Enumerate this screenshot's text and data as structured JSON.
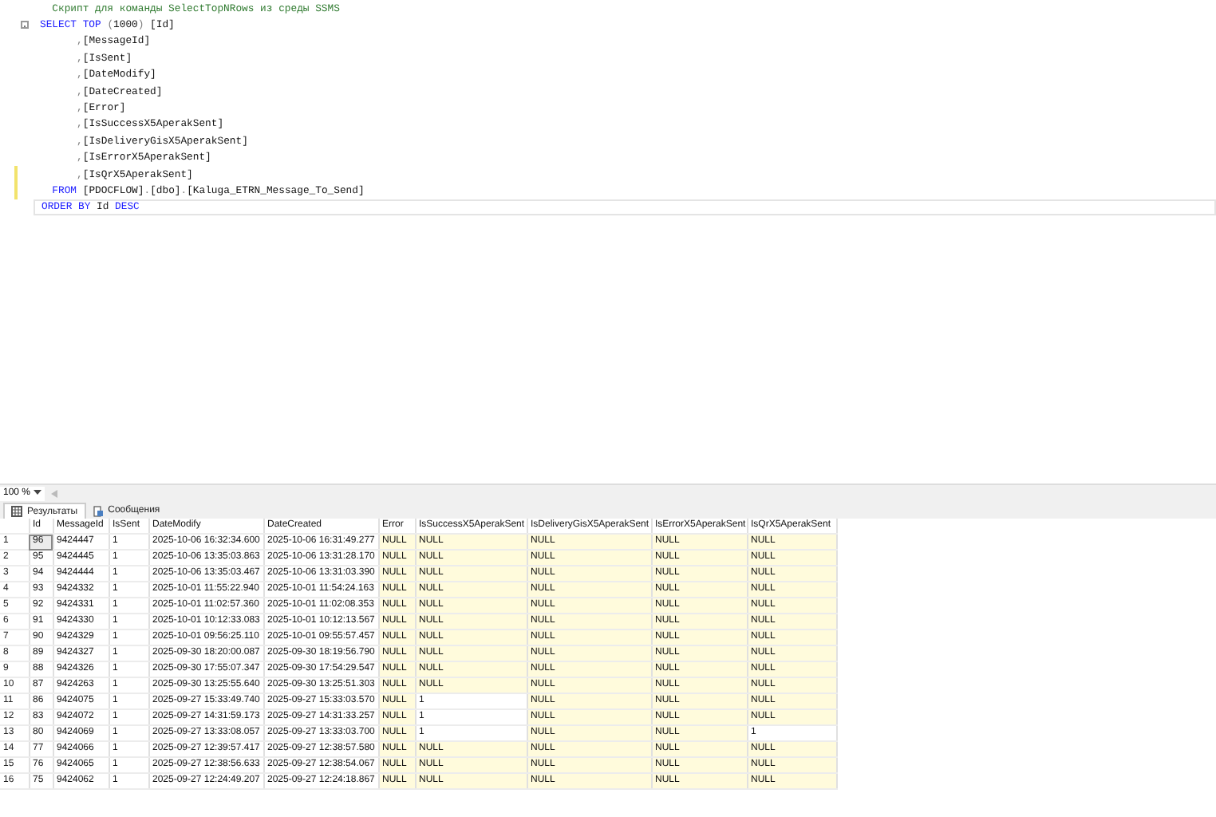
{
  "editor": {
    "lines": [
      {
        "changed": false,
        "current": false,
        "fold": false,
        "kind": "comment",
        "tokens": [
          {
            "text": "Скрипт для команды SelectTopNRows из среды SSMS",
            "kind": "comment"
          }
        ]
      },
      {
        "changed": false,
        "current": false,
        "fold": true,
        "kind": "select",
        "tokens": [
          {
            "text": "SELECT TOP ",
            "kind": "keyword"
          },
          {
            "text": "(",
            "kind": "punct"
          },
          {
            "text": "1000",
            "kind": "plain"
          },
          {
            "text": ") ",
            "kind": "punct"
          },
          {
            "text": "[Id]",
            "kind": "plain"
          }
        ]
      },
      {
        "changed": false,
        "current": false,
        "fold": false,
        "kind": "column",
        "tokens": [
          {
            "text": ",",
            "kind": "punct"
          },
          {
            "text": "[MessageId]",
            "kind": "plain"
          }
        ]
      },
      {
        "changed": false,
        "current": false,
        "fold": false,
        "kind": "column",
        "tokens": [
          {
            "text": ",",
            "kind": "punct"
          },
          {
            "text": "[IsSent]",
            "kind": "plain"
          }
        ]
      },
      {
        "changed": false,
        "current": false,
        "fold": false,
        "kind": "column",
        "tokens": [
          {
            "text": ",",
            "kind": "punct"
          },
          {
            "text": "[DateModify]",
            "kind": "plain"
          }
        ]
      },
      {
        "changed": false,
        "current": false,
        "fold": false,
        "kind": "column",
        "tokens": [
          {
            "text": ",",
            "kind": "punct"
          },
          {
            "text": "[DateCreated]",
            "kind": "plain"
          }
        ]
      },
      {
        "changed": false,
        "current": false,
        "fold": false,
        "kind": "column",
        "tokens": [
          {
            "text": ",",
            "kind": "punct"
          },
          {
            "text": "[Error]",
            "kind": "plain"
          }
        ]
      },
      {
        "changed": false,
        "current": false,
        "fold": false,
        "kind": "column",
        "tokens": [
          {
            "text": ",",
            "kind": "punct"
          },
          {
            "text": "[IsSuccessX5AperakSent]",
            "kind": "plain"
          }
        ]
      },
      {
        "changed": false,
        "current": false,
        "fold": false,
        "kind": "column",
        "tokens": [
          {
            "text": ",",
            "kind": "punct"
          },
          {
            "text": "[IsDeliveryGisX5AperakSent]",
            "kind": "plain"
          }
        ]
      },
      {
        "changed": false,
        "current": false,
        "fold": false,
        "kind": "column",
        "tokens": [
          {
            "text": ",",
            "kind": "punct"
          },
          {
            "text": "[IsErrorX5AperakSent]",
            "kind": "plain"
          }
        ]
      },
      {
        "changed": true,
        "current": false,
        "fold": false,
        "kind": "column",
        "tokens": [
          {
            "text": ",",
            "kind": "punct"
          },
          {
            "text": "[IsQrX5AperakSent]",
            "kind": "plain"
          }
        ]
      },
      {
        "changed": true,
        "current": false,
        "fold": false,
        "kind": "from",
        "tokens": [
          {
            "text": "FROM ",
            "kind": "keyword"
          },
          {
            "text": "[PDOCFLOW]",
            "kind": "plain"
          },
          {
            "text": ".",
            "kind": "punct"
          },
          {
            "text": "[dbo]",
            "kind": "plain"
          },
          {
            "text": ".",
            "kind": "punct"
          },
          {
            "text": "[Kaluga_ETRN_Message_To_Send]",
            "kind": "plain"
          }
        ]
      },
      {
        "changed": false,
        "current": true,
        "fold": false,
        "kind": "order",
        "tokens": [
          {
            "text": "ORDER BY ",
            "kind": "keyword"
          },
          {
            "text": "Id ",
            "kind": "plain"
          },
          {
            "text": "DESC",
            "kind": "keyword"
          }
        ]
      }
    ]
  },
  "zoom": {
    "value": "100 %"
  },
  "tabs": [
    {
      "label": "Результаты",
      "selected": true
    },
    {
      "label": "Сообщения",
      "selected": false
    }
  ],
  "table": {
    "columns": [
      "Id",
      "MessageId",
      "IsSent",
      "DateModify",
      "DateCreated",
      "Error",
      "IsSuccessX5AperakSent",
      "IsDeliveryGisX5AperakSent",
      "IsErrorX5AperakSent",
      "IsQrX5AperakSent"
    ],
    "rows": [
      {
        "row_number": "1",
        "selected": true,
        "cells": [
          "96",
          "9424447",
          "1",
          "2025-10-06 16:32:34.600",
          "2025-10-06 16:31:49.277"
        ],
        "flags": [
          {
            "text": "NULL",
            "null": true
          },
          {
            "text": "NULL",
            "null": true
          },
          {
            "text": "NULL",
            "null": true
          },
          {
            "text": "NULL",
            "null": true
          },
          {
            "text": "NULL",
            "null": true
          }
        ]
      },
      {
        "row_number": "2",
        "selected": false,
        "cells": [
          "95",
          "9424445",
          "1",
          "2025-10-06 13:35:03.863",
          "2025-10-06 13:31:28.170"
        ],
        "flags": [
          {
            "text": "NULL",
            "null": true
          },
          {
            "text": "NULL",
            "null": true
          },
          {
            "text": "NULL",
            "null": true
          },
          {
            "text": "NULL",
            "null": true
          },
          {
            "text": "NULL",
            "null": true
          }
        ]
      },
      {
        "row_number": "3",
        "selected": false,
        "cells": [
          "94",
          "9424444",
          "1",
          "2025-10-06 13:35:03.467",
          "2025-10-06 13:31:03.390"
        ],
        "flags": [
          {
            "text": "NULL",
            "null": true
          },
          {
            "text": "NULL",
            "null": true
          },
          {
            "text": "NULL",
            "null": true
          },
          {
            "text": "NULL",
            "null": true
          },
          {
            "text": "NULL",
            "null": true
          }
        ]
      },
      {
        "row_number": "4",
        "selected": false,
        "cells": [
          "93",
          "9424332",
          "1",
          "2025-10-01 11:55:22.940",
          "2025-10-01 11:54:24.163"
        ],
        "flags": [
          {
            "text": "NULL",
            "null": true
          },
          {
            "text": "NULL",
            "null": true
          },
          {
            "text": "NULL",
            "null": true
          },
          {
            "text": "NULL",
            "null": true
          },
          {
            "text": "NULL",
            "null": true
          }
        ]
      },
      {
        "row_number": "5",
        "selected": false,
        "cells": [
          "92",
          "9424331",
          "1",
          "2025-10-01 11:02:57.360",
          "2025-10-01 11:02:08.353"
        ],
        "flags": [
          {
            "text": "NULL",
            "null": true
          },
          {
            "text": "NULL",
            "null": true
          },
          {
            "text": "NULL",
            "null": true
          },
          {
            "text": "NULL",
            "null": true
          },
          {
            "text": "NULL",
            "null": true
          }
        ]
      },
      {
        "row_number": "6",
        "selected": false,
        "cells": [
          "91",
          "9424330",
          "1",
          "2025-10-01 10:12:33.083",
          "2025-10-01 10:12:13.567"
        ],
        "flags": [
          {
            "text": "NULL",
            "null": true
          },
          {
            "text": "NULL",
            "null": true
          },
          {
            "text": "NULL",
            "null": true
          },
          {
            "text": "NULL",
            "null": true
          },
          {
            "text": "NULL",
            "null": true
          }
        ]
      },
      {
        "row_number": "7",
        "selected": false,
        "cells": [
          "90",
          "9424329",
          "1",
          "2025-10-01 09:56:25.110",
          "2025-10-01 09:55:57.457"
        ],
        "flags": [
          {
            "text": "NULL",
            "null": true
          },
          {
            "text": "NULL",
            "null": true
          },
          {
            "text": "NULL",
            "null": true
          },
          {
            "text": "NULL",
            "null": true
          },
          {
            "text": "NULL",
            "null": true
          }
        ]
      },
      {
        "row_number": "8",
        "selected": false,
        "cells": [
          "89",
          "9424327",
          "1",
          "2025-09-30 18:20:00.087",
          "2025-09-30 18:19:56.790"
        ],
        "flags": [
          {
            "text": "NULL",
            "null": true
          },
          {
            "text": "NULL",
            "null": true
          },
          {
            "text": "NULL",
            "null": true
          },
          {
            "text": "NULL",
            "null": true
          },
          {
            "text": "NULL",
            "null": true
          }
        ]
      },
      {
        "row_number": "9",
        "selected": false,
        "cells": [
          "88",
          "9424326",
          "1",
          "2025-09-30 17:55:07.347",
          "2025-09-30 17:54:29.547"
        ],
        "flags": [
          {
            "text": "NULL",
            "null": true
          },
          {
            "text": "NULL",
            "null": true
          },
          {
            "text": "NULL",
            "null": true
          },
          {
            "text": "NULL",
            "null": true
          },
          {
            "text": "NULL",
            "null": true
          }
        ]
      },
      {
        "row_number": "10",
        "selected": false,
        "cells": [
          "87",
          "9424263",
          "1",
          "2025-09-30 13:25:55.640",
          "2025-09-30 13:25:51.303"
        ],
        "flags": [
          {
            "text": "NULL",
            "null": true
          },
          {
            "text": "NULL",
            "null": true
          },
          {
            "text": "NULL",
            "null": true
          },
          {
            "text": "NULL",
            "null": true
          },
          {
            "text": "NULL",
            "null": true
          }
        ]
      },
      {
        "row_number": "11",
        "selected": false,
        "cells": [
          "86",
          "9424075",
          "1",
          "2025-09-27 15:33:49.740",
          "2025-09-27 15:33:03.570"
        ],
        "flags": [
          {
            "text": "NULL",
            "null": true
          },
          {
            "text": "1",
            "null": false
          },
          {
            "text": "NULL",
            "null": true
          },
          {
            "text": "NULL",
            "null": true
          },
          {
            "text": "NULL",
            "null": true
          }
        ]
      },
      {
        "row_number": "12",
        "selected": false,
        "cells": [
          "83",
          "9424072",
          "1",
          "2025-09-27 14:31:59.173",
          "2025-09-27 14:31:33.257"
        ],
        "flags": [
          {
            "text": "NULL",
            "null": true
          },
          {
            "text": "1",
            "null": false
          },
          {
            "text": "NULL",
            "null": true
          },
          {
            "text": "NULL",
            "null": true
          },
          {
            "text": "NULL",
            "null": true
          }
        ]
      },
      {
        "row_number": "13",
        "selected": false,
        "cells": [
          "80",
          "9424069",
          "1",
          "2025-09-27 13:33:08.057",
          "2025-09-27 13:33:03.700"
        ],
        "flags": [
          {
            "text": "NULL",
            "null": true
          },
          {
            "text": "1",
            "null": false
          },
          {
            "text": "NULL",
            "null": true
          },
          {
            "text": "NULL",
            "null": true
          },
          {
            "text": "1",
            "null": false
          }
        ]
      },
      {
        "row_number": "14",
        "selected": false,
        "cells": [
          "77",
          "9424066",
          "1",
          "2025-09-27 12:39:57.417",
          "2025-09-27 12:38:57.580"
        ],
        "flags": [
          {
            "text": "NULL",
            "null": true
          },
          {
            "text": "NULL",
            "null": true
          },
          {
            "text": "NULL",
            "null": true
          },
          {
            "text": "NULL",
            "null": true
          },
          {
            "text": "NULL",
            "null": true
          }
        ]
      },
      {
        "row_number": "15",
        "selected": false,
        "cells": [
          "76",
          "9424065",
          "1",
          "2025-09-27 12:38:56.633",
          "2025-09-27 12:38:54.067"
        ],
        "flags": [
          {
            "text": "NULL",
            "null": true
          },
          {
            "text": "NULL",
            "null": true
          },
          {
            "text": "NULL",
            "null": true
          },
          {
            "text": "NULL",
            "null": true
          },
          {
            "text": "NULL",
            "null": true
          }
        ]
      },
      {
        "row_number": "16",
        "selected": false,
        "cells": [
          "75",
          "9424062",
          "1",
          "2025-09-27 12:24:49.207",
          "2025-09-27 12:24:18.867"
        ],
        "flags": [
          {
            "text": "NULL",
            "null": true
          },
          {
            "text": "NULL",
            "null": true
          },
          {
            "text": "NULL",
            "null": true
          },
          {
            "text": "NULL",
            "null": true
          },
          {
            "text": "NULL",
            "null": true
          }
        ]
      }
    ]
  }
}
